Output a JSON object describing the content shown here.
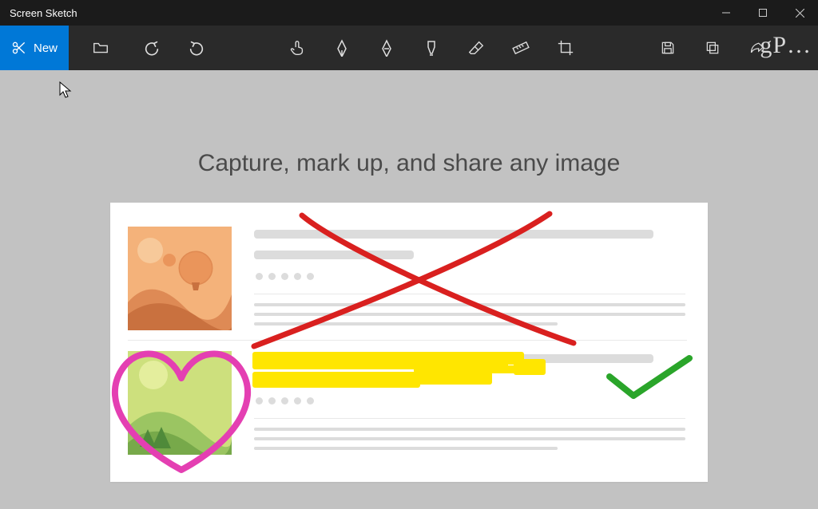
{
  "window": {
    "title": "Screen Sketch"
  },
  "toolbar": {
    "new_label": "New"
  },
  "main": {
    "headline": "Capture, mark up, and share any image"
  },
  "watermark": {
    "text": "gP…"
  }
}
